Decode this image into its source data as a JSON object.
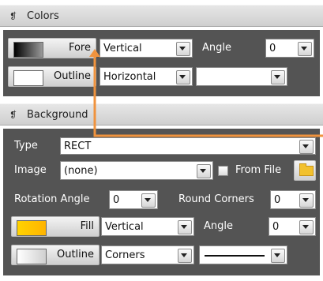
{
  "colors_section": {
    "title": "Colors",
    "fore_button": {
      "label": "Fore",
      "swatch_from": "#000000",
      "swatch_to": "#9a9a9a"
    },
    "fore_direction": "Vertical",
    "angle_label": "Angle",
    "angle_value": "0",
    "outline_button": {
      "label": "Outline",
      "swatch": "#ffffff"
    },
    "outline_direction": "Horizontal",
    "outline_extra": ""
  },
  "background_section": {
    "title": "Background",
    "type_label": "Type",
    "type_value": "RECT",
    "image_label": "Image",
    "image_value": "(none)",
    "from_file_label": "From File",
    "rotation_label": "Rotation Angle",
    "rotation_value": "0",
    "round_corners_label": "Round Corners",
    "round_corners_value": "0",
    "fill_button": {
      "label": "Fill",
      "swatch_from": "#ffd200",
      "swatch_to": "#ffb400"
    },
    "fill_direction": "Vertical",
    "angle_label": "Angle",
    "angle_value": "0",
    "outline_button": {
      "label": "Outline",
      "swatch_from": "#ffffff",
      "swatch_to": "#d0d0d0"
    },
    "outline_mode": "Corners"
  },
  "accent": {
    "orange": "#f0933e",
    "panel": "#545454"
  }
}
